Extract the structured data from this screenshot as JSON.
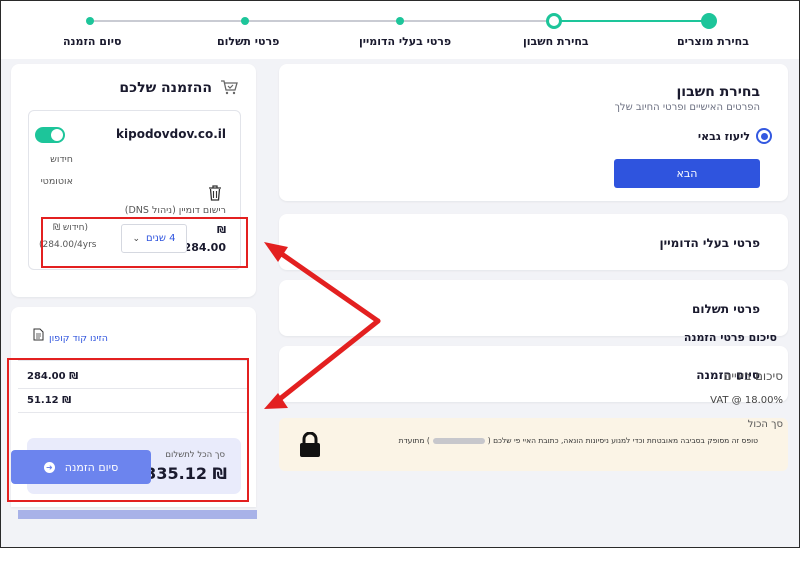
{
  "stepper": {
    "steps": [
      {
        "label": "בחירת מוצרים"
      },
      {
        "label": "בחירת חשבון"
      },
      {
        "label": "פרטי בעלי הדומיין"
      },
      {
        "label": "פרטי תשלום"
      },
      {
        "label": "סיום הזמנה"
      }
    ]
  },
  "account": {
    "title": "בחירת חשבון",
    "subtitle": "הפרטים האישיים ופרטי החיוב שלך",
    "option_label": "ליעוז גבאי",
    "next_label": "הבא"
  },
  "sections": {
    "owners": "פרטי בעלי הדומיין",
    "payment": "פרטי תשלום",
    "finish": "סיום הזמנה"
  },
  "notice": {
    "text_before": "טופס זה מסופק בסביבה מאובטחת וכדי למנוע ניסיונות הונאה, כתובת האיי פי שלכם (",
    "text_after": ") מתועדת"
  },
  "order": {
    "title": "ההזמנה שלכם",
    "domain": "kipodovdov.co.il",
    "renew_line1": "חידוש",
    "renew_line2": "אוטומטי",
    "registration": "רישום דומיין (ניהול DNS)",
    "currency": "₪",
    "price": "284.00",
    "years": "4 שנים",
    "renewal_price_1": "(חידוש ₪",
    "renewal_price_2": "(284.00/4yrs"
  },
  "summary": {
    "title": "סיכום פרטי הזמנה",
    "coupon": "הזינו קוד קופון",
    "subtotal_label": "סיכום ביניים",
    "subtotal_value": "284.00 ₪",
    "vat_label": "VAT @ 18.00%",
    "vat_value": "51.12 ₪",
    "total_label": "סך הכול",
    "pay_caption": "סך הכל לתשלום",
    "pay_amount": "335.12 ₪",
    "finish_label": "סיום הזמנה"
  },
  "colors": {
    "accent": "#2f54de",
    "success": "#1dc59a",
    "annotation": "#e32020"
  }
}
